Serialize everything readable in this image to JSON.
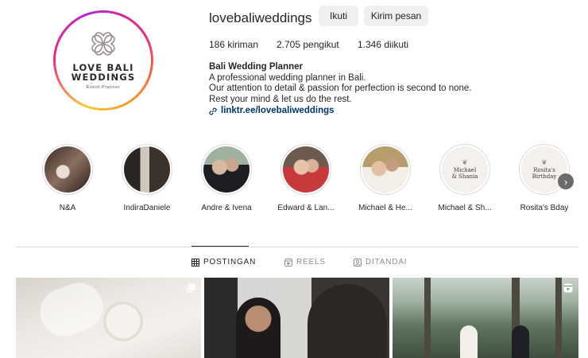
{
  "profile": {
    "username": "lovebaliweddings",
    "follow_label": "Ikuti",
    "message_label": "Kirim pesan",
    "logo": {
      "line1": "LOVE BALI",
      "line2": "WEDDINGS",
      "tagline": "Event Planner"
    },
    "stats": {
      "posts": "186 kiriman",
      "followers": "2.705 pengikut",
      "following": "1.346 diikuti"
    },
    "bio": {
      "name": "Bali Wedding Planner",
      "lines": [
        "A professional wedding planner in Bali.",
        "Our attention to detail & passion for perfection is second to none.",
        "Rest your mind & let us do the rest."
      ],
      "link": "linktr.ee/lovebaliweddings"
    }
  },
  "highlights": [
    {
      "label": "N&A",
      "thumb": "photo"
    },
    {
      "label": "IndiraDaniele",
      "thumb": "photo"
    },
    {
      "label": "Andre & Ivena",
      "thumb": "photo"
    },
    {
      "label": "Edward & Lan...",
      "thumb": "photo"
    },
    {
      "label": "Michael & He...",
      "thumb": "photo"
    },
    {
      "label": "Michael & Sh...",
      "thumb": "card",
      "card_text": [
        "Michael",
        "& Shania"
      ]
    },
    {
      "label": "Rosita's Bday",
      "thumb": "card",
      "card_text": [
        "Rosita's",
        "Birthday"
      ]
    }
  ],
  "tabs": [
    {
      "label": "POSTINGAN",
      "icon": "grid-icon",
      "active": true
    },
    {
      "label": "REELS",
      "icon": "reels-icon",
      "active": false
    },
    {
      "label": "DITANDAI",
      "icon": "tagged-icon",
      "active": false
    }
  ],
  "posts": [
    {
      "type": "carousel",
      "icon": "carousel-icon"
    },
    {
      "type": "photo"
    },
    {
      "type": "reel",
      "icon": "reels-icon"
    }
  ],
  "colors": {
    "link": "#00376b",
    "button_bg": "#efefef",
    "text": "#262626",
    "muted": "#8e8e8e",
    "divider": "#dbdbdb"
  }
}
